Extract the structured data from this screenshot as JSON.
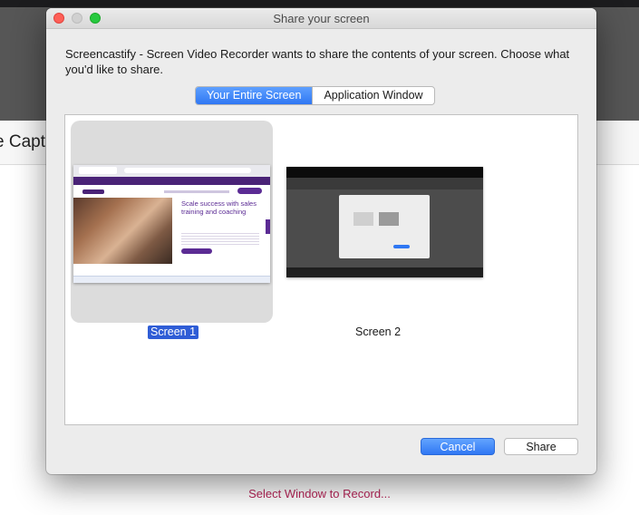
{
  "background": {
    "partial_title": "e Capt",
    "footer_link": "Select Window to Record..."
  },
  "dialog": {
    "title": "Share your screen",
    "message": "Screencastify - Screen Video Recorder wants to share the contents of your screen. Choose what you'd like to share.",
    "tabs": [
      {
        "label": "Your Entire Screen",
        "selected": true
      },
      {
        "label": "Application Window",
        "selected": false
      }
    ],
    "screens": [
      {
        "label": "Screen 1",
        "selected": true,
        "preview_heading": "Scale success with sales training and coaching"
      },
      {
        "label": "Screen 2",
        "selected": false
      }
    ],
    "buttons": {
      "cancel": "Cancel",
      "share": "Share"
    }
  },
  "colors": {
    "accent": "#2f77f3",
    "selection": "#2f5dd6",
    "link": "#b8275a",
    "close": "#fe5f57",
    "maximize": "#27c93f"
  }
}
